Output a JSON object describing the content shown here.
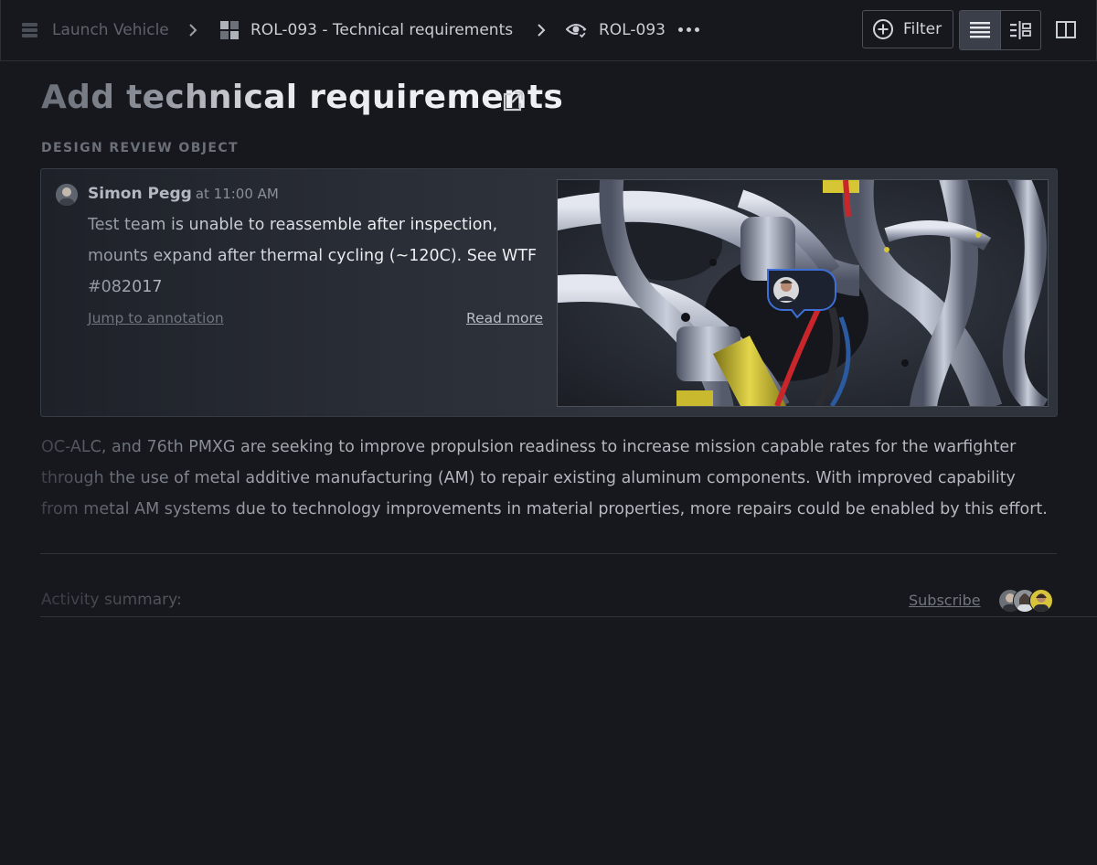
{
  "breadcrumb": {
    "items": [
      {
        "label": "Launch Vehicle",
        "icon": "stack-icon"
      },
      {
        "label": "ROL-093 - Technical requirements",
        "icon": "grid-icon"
      },
      {
        "label": "ROL-093",
        "icon": "eye-check-icon"
      }
    ]
  },
  "toolbar": {
    "filter_label": "Filter",
    "views": [
      "list-view-icon",
      "split-view-icon"
    ],
    "active_view": "list-view-icon",
    "panel_icon": "columns-icon"
  },
  "page": {
    "title": "Add technical requirements",
    "section_label": "DESIGN REVIEW OBJECT"
  },
  "review": {
    "author": "Simon Pegg",
    "time": "at 11:00 AM",
    "comment": "Test team is unable to reassemble after inspection, mounts expand after thermal cycling (~120C). See WTF #082017",
    "jump_link": "Jump to annotation",
    "read_more": "Read more"
  },
  "body": {
    "paragraph": "OC-ALC, and 76th PMXG are seeking to improve propulsion readiness to increase mission capable rates for the warfighter through the use of metal additive manufacturing (AM) to repair existing aluminum components. With improved capability from metal AM systems due to technology improvements in material properties, more repairs could be enabled by this effort."
  },
  "activity": {
    "label": "Activity summary:",
    "subscribe": "Subscribe"
  },
  "colors": {
    "background": "#16181d",
    "card": "#2f333b",
    "accent_red": "#c8262a",
    "accent_yellow": "#d6c634",
    "accent_blue": "#2c5aa0"
  }
}
